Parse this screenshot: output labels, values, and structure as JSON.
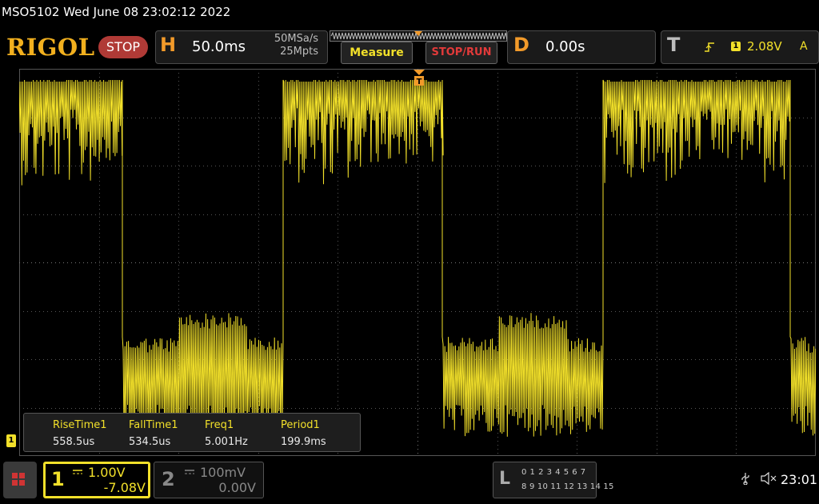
{
  "header": {
    "model_datetime": "MSO5102  Wed June 08 23:02:12 2022",
    "logo": "RIGOL",
    "run_state": "STOP"
  },
  "horizontal": {
    "letter": "H",
    "timebase": "50.0ms",
    "sample_rate": "50MSa/s",
    "memory_depth": "25Mpts"
  },
  "buttons": {
    "measure": "Measure",
    "stop_run": "STOP/RUN"
  },
  "delay": {
    "letter": "D",
    "value": "0.00s"
  },
  "trigger": {
    "letter": "T",
    "edge_icon": "rising-edge-icon",
    "source": "1",
    "level": "2.08V",
    "mode": "A"
  },
  "measurements": {
    "headers": [
      "RiseTime1",
      "FallTime1",
      "Freq1",
      "Period1"
    ],
    "values": [
      "558.5us",
      "534.5us",
      "5.001Hz",
      "199.9ms"
    ]
  },
  "channel1": {
    "number": "1",
    "scale": "1.00V",
    "offset": "-7.08V",
    "coupling_icon": "dc-coupling-icon",
    "flag": "1"
  },
  "channel2": {
    "number": "2",
    "scale": "100mV",
    "offset": "0.00V",
    "coupling_icon": "dc-coupling-icon"
  },
  "logic": {
    "letter": "L",
    "row1": "0 1 2 3  4 5 6 7",
    "row2": "8 9 10 11 12 13 14 15"
  },
  "status": {
    "usb_icon": "usb-icon",
    "speaker_icon": "speaker-muted-icon",
    "clock": "23:01"
  },
  "colors": {
    "ch1": "#f2e02a",
    "brand": "#f2b01e",
    "stop": "#b03a36",
    "horizontal": "#f29a2a"
  },
  "waveform": {
    "channel": "1",
    "frequency_hz": 5.001,
    "period_ms": 199.9
  }
}
